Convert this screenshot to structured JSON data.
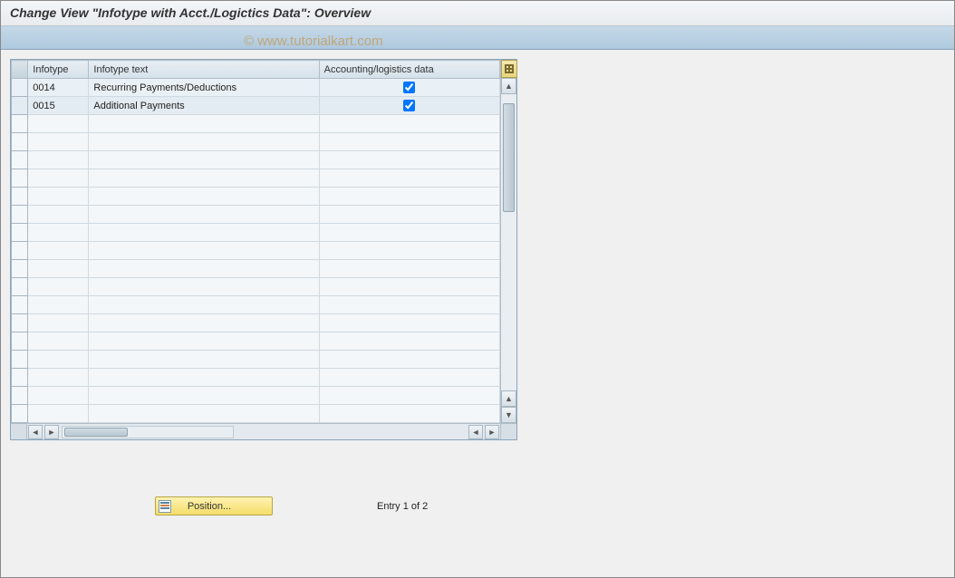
{
  "header": {
    "title": "Change View \"Infotype with Acct./Logictics Data\": Overview"
  },
  "watermark": "© www.tutorialkart.com",
  "table": {
    "columns": {
      "infotype": "Infotype",
      "text": "Infotype text",
      "acc": "Accounting/logistics data"
    },
    "rows": [
      {
        "infotype": "0014",
        "text": "Recurring Payments/Deductions",
        "acc": true
      },
      {
        "infotype": "0015",
        "text": "Additional Payments",
        "acc": true
      }
    ],
    "empty_row_count": 17
  },
  "footer": {
    "position_btn": "Position...",
    "entry_text": "Entry 1 of 2"
  }
}
